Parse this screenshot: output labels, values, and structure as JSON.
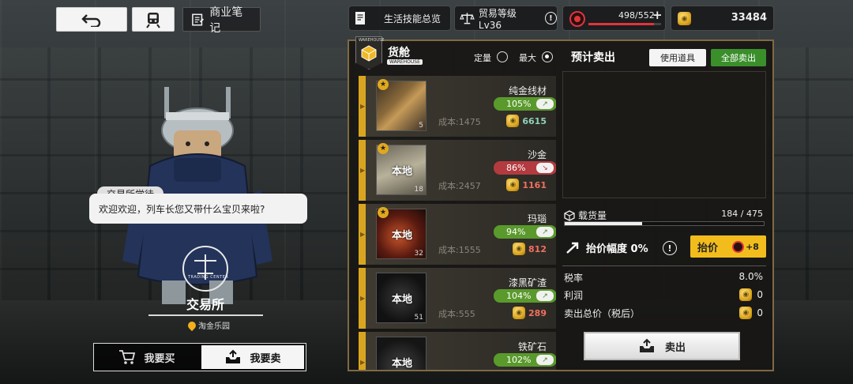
{
  "top_left": {
    "back_icon": "back-arrow-icon",
    "train_icon": "train-icon",
    "notes_label": "商业笔记"
  },
  "top_bar": {
    "skills_label": "生活技能总览",
    "trade_level_label": "贸易等级Lv36",
    "stamina_value": "498/552",
    "coins": "33484",
    "accent_red": "#e0343a"
  },
  "character": {
    "speaker": "交易所学徒",
    "speech": "欢迎欢迎，列车长您又带什么宝贝来啦?",
    "shop_name": "交易所",
    "location": "淘金乐园",
    "emblem_text": "TRADING CENTER"
  },
  "mode_toggle": {
    "buy_label": "我要买",
    "sell_label": "我要卖",
    "active": "sell"
  },
  "panel": {
    "warehouse_badge": "WAREHOUSE",
    "title": "货舱",
    "title_sub": "WAREHOUSE",
    "qty_fixed_label": "定量",
    "qty_max_label": "最大",
    "selected_qty_mode": "最大",
    "preview_title": "预计卖出",
    "use_item_label": "使用道具",
    "sell_all_label": "全部卖出",
    "accent_gold": "#d9a521",
    "accent_green": "#3a8f2b"
  },
  "items": [
    {
      "name": "纯金线材",
      "star": true,
      "local": "",
      "qty": "5",
      "pct": "105%",
      "trend": "up",
      "cost": "成本:1475",
      "value": "6615",
      "value_color": "green"
    },
    {
      "name": "沙金",
      "star": true,
      "local": "本地",
      "qty": "18",
      "pct": "86%",
      "trend": "down",
      "cost": "成本:2457",
      "value": "1161",
      "value_color": "red"
    },
    {
      "name": "玛瑙",
      "star": true,
      "local": "本地",
      "qty": "32",
      "pct": "94%",
      "trend": "up",
      "cost": "成本:1555",
      "value": "812",
      "value_color": "red"
    },
    {
      "name": "漆黑矿渣",
      "star": false,
      "local": "本地",
      "qty": "51",
      "pct": "104%",
      "trend": "up",
      "cost": "成本:555",
      "value": "289",
      "value_color": "red"
    },
    {
      "name": "铁矿石",
      "star": false,
      "local": "本地",
      "qty": "",
      "pct": "102%",
      "trend": "up",
      "cost": "",
      "value": "",
      "value_color": "red"
    }
  ],
  "summary": {
    "capacity_label": "载货量",
    "capacity_value": "184 / 475",
    "capacity_fraction": 0.387,
    "raise_label": "抬价幅度 0%",
    "raise_button": "抬价",
    "raise_cost": "+8",
    "tax_label": "税率",
    "tax_value": "8.0%",
    "profit_label": "利润",
    "profit_value": "0",
    "total_label": "卖出总价（税后）",
    "total_value": "0",
    "sell_button": "卖出"
  }
}
